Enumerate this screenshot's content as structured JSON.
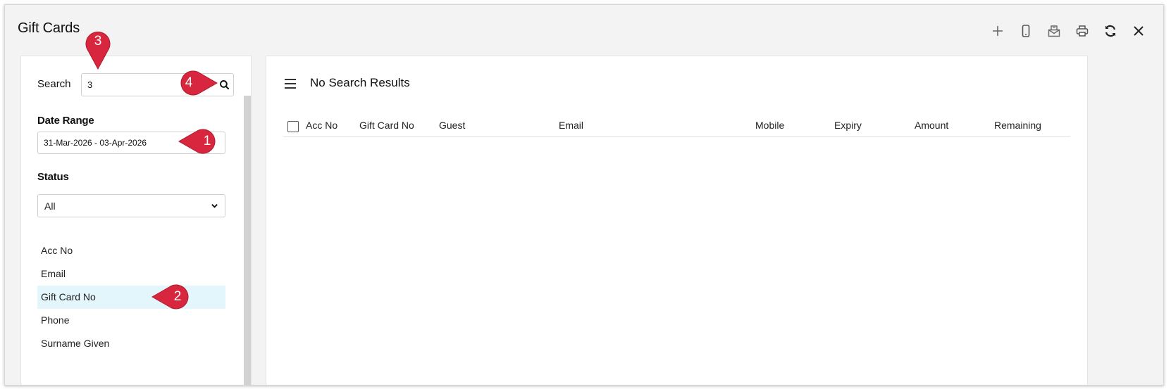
{
  "window": {
    "title": "Gift Cards"
  },
  "toolbar": {
    "icons": [
      "plus-icon",
      "mobile-icon",
      "email-icon",
      "print-icon",
      "refresh-icon",
      "close-icon"
    ]
  },
  "filters": {
    "search_label": "Search",
    "search_value": "3",
    "date_range_label": "Date Range",
    "date_range_value": "31-Mar-2026 - 03-Apr-2026",
    "status_label": "Status",
    "status_value": "All",
    "search_by": [
      {
        "label": "Acc No",
        "selected": false
      },
      {
        "label": "Email",
        "selected": false
      },
      {
        "label": "Gift Card No",
        "selected": true
      },
      {
        "label": "Phone",
        "selected": false
      },
      {
        "label": "Surname Given",
        "selected": false
      }
    ]
  },
  "results": {
    "title": "No Search Results",
    "columns": [
      "Acc No",
      "Gift Card No",
      "Guest",
      "Email",
      "Mobile",
      "Expiry",
      "Amount",
      "Remaining"
    ]
  },
  "callouts": [
    "1",
    "2",
    "3",
    "4"
  ],
  "colors": {
    "callout": "#d7263d",
    "selected_row": "#e3f6fc"
  }
}
